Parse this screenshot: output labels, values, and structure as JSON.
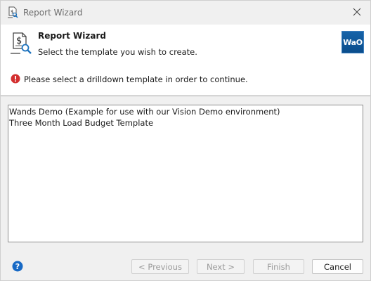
{
  "window": {
    "title": "Report Wizard",
    "icon": "report-wizard-icon",
    "close_icon": "close-icon"
  },
  "header": {
    "title": "Report Wizard",
    "subtitle": "Select the template you wish to create.",
    "brand_logo": "WaO",
    "brand_color": "#0b5394",
    "error_message": "Please select a drilldown template in order to continue.",
    "error_color": "#d32f2f"
  },
  "templates": {
    "items": [
      {
        "label": "Wands Demo (Example for use with our Vision Demo environment)"
      },
      {
        "label": "Three Month Load Budget Template"
      }
    ]
  },
  "footer": {
    "help_icon": "help-icon",
    "help_color": "#1769c5",
    "previous_label": "< Previous",
    "next_label": "Next >",
    "finish_label": "Finish",
    "cancel_label": "Cancel"
  }
}
